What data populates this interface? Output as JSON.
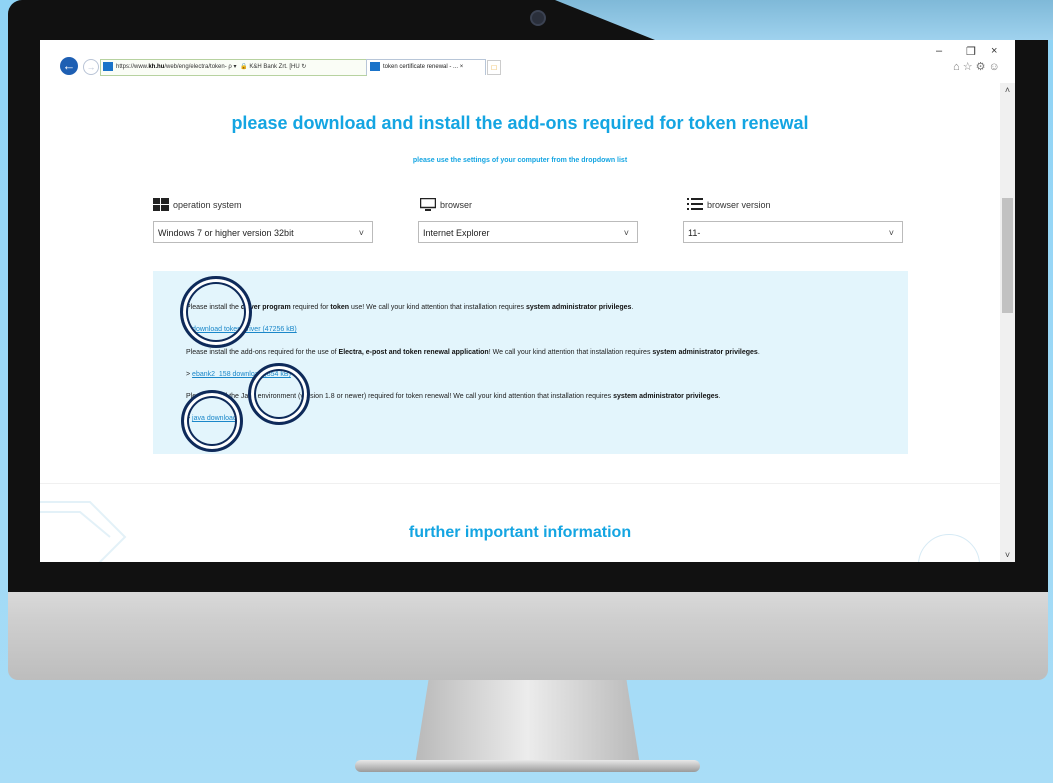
{
  "browser": {
    "address_scheme": "https://www.",
    "address_domain": "kh.hu",
    "address_path": "/web/eng/electra/token-",
    "address_controls": "ρ ▾",
    "site_identity": "K&H Bank Zrt. [HU",
    "refresh_glyph": "↻",
    "tab_title": "token certificate renewal - ...",
    "tab_close": "×",
    "minimize": "–",
    "restore": "❐",
    "close": "×",
    "tool_icons": "⌂ ☆ ⚙ ☺"
  },
  "page": {
    "title": "please download and install the add-ons required for token renewal",
    "subtitle": "please use the settings of your computer from the dropdown list",
    "selectors": [
      {
        "label": "operation system",
        "value": "Windows 7 or higher version 32bit"
      },
      {
        "label": "browser",
        "value": "Internet Explorer"
      },
      {
        "label": "browser version",
        "value": "11-"
      }
    ],
    "chevron": "˅",
    "info": {
      "l1_a": "Please install the ",
      "l1_b": "driver program",
      "l1_c": " required for ",
      "l1_d": "token",
      "l1_e": " use! We call your kind attention that installation requires ",
      "l1_f": "system administrator privileges",
      "l1_g": ".",
      "l2_prefix": "> ",
      "l2_link": "download token driver (47256 kB)",
      "l3_a": "Please install the add-ons required for the use of ",
      "l3_b": "Electra, e-post and token renewal application",
      "l3_c": "! We call your kind attention that installation requires ",
      "l3_d": "system administrator privileges",
      "l3_e": ".",
      "l4_prefix": "> ",
      "l4_link": "ebank2_158 download (854 kB)",
      "l5_a": "Please install the Java environment (version 1.8 or newer) required for  token renewal! We call your kind attention that installation requires ",
      "l5_b": "system administrator privileges",
      "l5_c": ".",
      "l6_prefix": "> ",
      "l6_link": "java download"
    },
    "further": "further important information"
  },
  "scroll_up": "˄",
  "scroll_down": "˅",
  "colors": {
    "accent": "#14a5e2",
    "info_bg": "#e3f5fc",
    "circle": "#0e2a5a"
  }
}
